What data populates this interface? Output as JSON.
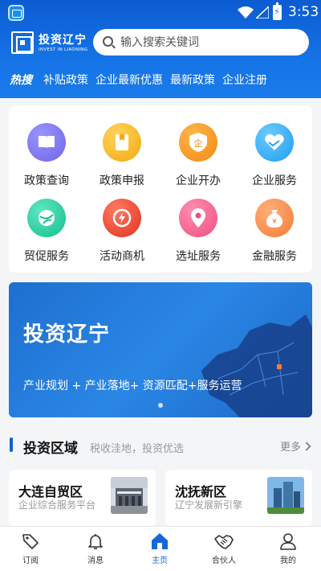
{
  "status_bar": {
    "time": "3:53"
  },
  "header": {
    "logo_title": "投资辽宁",
    "logo_subtitle": "INVEST IN LIAONING",
    "search_placeholder": "输入搜索关键词",
    "hot_label": "热搜",
    "hot_links": [
      "补贴政策",
      "企业最新优惠",
      "最新政策",
      "企业注册"
    ]
  },
  "services": [
    {
      "label": "政策查询",
      "icon": "book-icon",
      "color": "#7b73ee"
    },
    {
      "label": "政策申报",
      "icon": "bookmark-icon",
      "color": "#f5b520"
    },
    {
      "label": "企业开办",
      "icon": "enterprise-shield-icon",
      "color": "#f8981d"
    },
    {
      "label": "企业服务",
      "icon": "heart-hand-icon",
      "color": "#35b0f4"
    },
    {
      "label": "贸促服务",
      "icon": "globe-icon",
      "color": "#2fd0a6"
    },
    {
      "label": "活动商机",
      "icon": "lightning-icon",
      "color": "#f0483a"
    },
    {
      "label": "选址服务",
      "icon": "location-pin-icon",
      "color": "#f55e8b"
    },
    {
      "label": "金融服务",
      "icon": "money-bag-icon",
      "color": "#fb8a4f"
    }
  ],
  "banner": {
    "title": "投资辽宁",
    "subtitle": "产业规划 + 产业落地+ 资源匹配+服务运营"
  },
  "section": {
    "title": "投资区域",
    "subtitle": "税收洼地，投资优选",
    "more": "更多"
  },
  "regions": [
    {
      "name": "大连自贸区",
      "desc": "企业综合服务平台"
    },
    {
      "name": "沈抚新区",
      "desc": "辽宁发展新引擎"
    }
  ],
  "tabs": [
    {
      "label": "订阅",
      "icon": "tag-icon",
      "active": false
    },
    {
      "label": "消息",
      "icon": "bell-icon",
      "active": false
    },
    {
      "label": "主页",
      "icon": "home-icon",
      "active": true
    },
    {
      "label": "合伙人",
      "icon": "handshake-icon",
      "active": false
    },
    {
      "label": "我的",
      "icon": "user-icon",
      "active": false
    }
  ],
  "colors": {
    "primary": "#1668d9",
    "header": "#1573e6"
  }
}
